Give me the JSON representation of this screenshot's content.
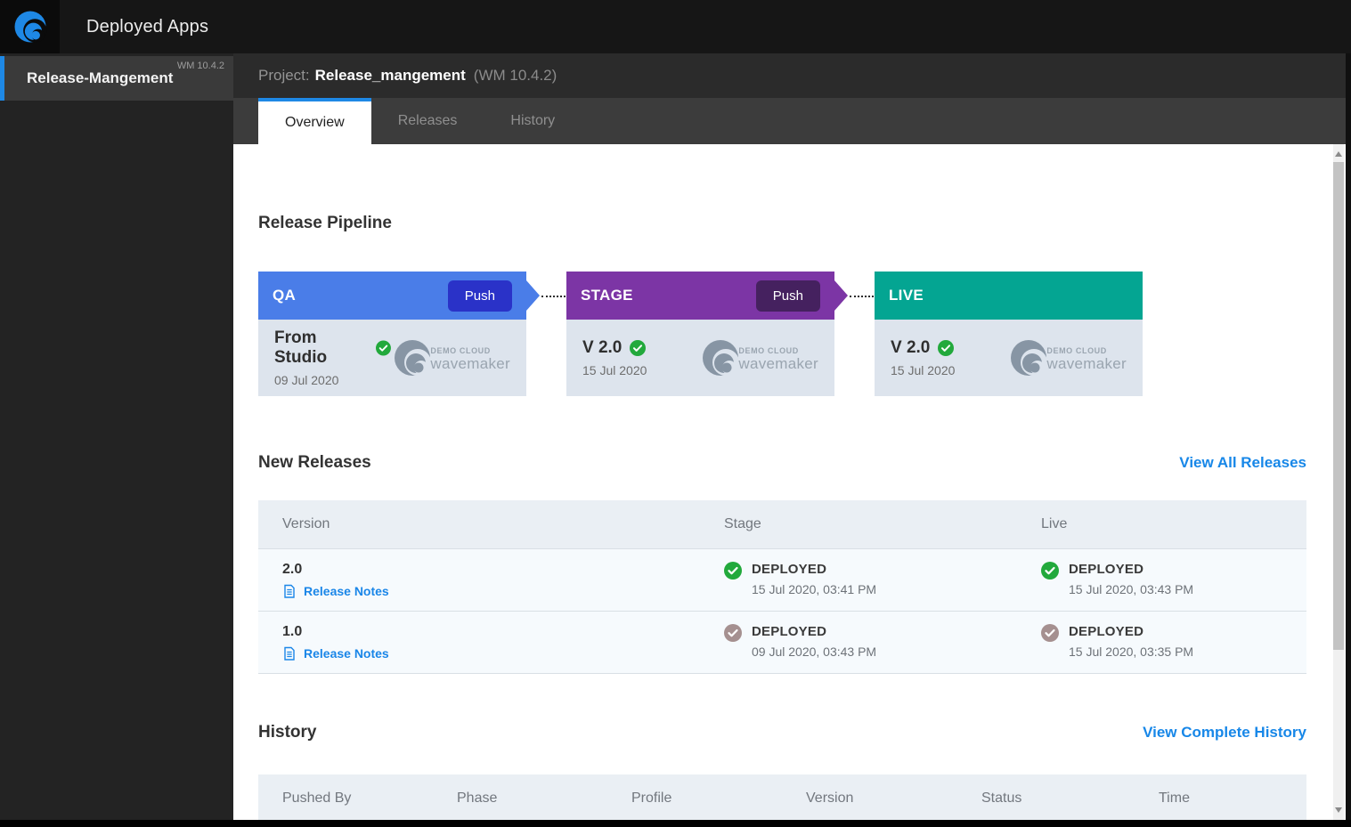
{
  "topbar": {
    "title": "Deployed Apps"
  },
  "sidebar": {
    "item": {
      "label": "Release-Mangement",
      "version": "WM 10.4.2"
    }
  },
  "project": {
    "prefix": "Project:",
    "name": "Release_mangement",
    "version": "(WM 10.4.2)"
  },
  "tabs": [
    {
      "label": "Overview",
      "active": true
    },
    {
      "label": "Releases",
      "active": false
    },
    {
      "label": "History",
      "active": false
    }
  ],
  "pipeline": {
    "title": "Release Pipeline",
    "stages": [
      {
        "name": "QA",
        "push_label": "Push",
        "version": "From Studio",
        "date": "09 Jul 2020",
        "status": "success",
        "cloud_line1": "DEMO CLOUD",
        "cloud_line2": "wavemaker",
        "header_color": "#4a7de8",
        "push_color": "#2a32c8"
      },
      {
        "name": "STAGE",
        "push_label": "Push",
        "version": "V 2.0",
        "date": "15 Jul 2020",
        "status": "success",
        "cloud_line1": "DEMO CLOUD",
        "cloud_line2": "wavemaker",
        "header_color": "#7c35a5",
        "push_color": "#45215f"
      },
      {
        "name": "LIVE",
        "version": "V 2.0",
        "date": "15 Jul 2020",
        "status": "success",
        "cloud_line1": "DEMO CLOUD",
        "cloud_line2": "wavemaker",
        "header_color": "#04a592"
      }
    ]
  },
  "new_releases": {
    "title": "New Releases",
    "view_link": "View All Releases",
    "columns": [
      "Version",
      "Stage",
      "Live"
    ],
    "rows": [
      {
        "version": "2.0",
        "release_notes_label": "Release Notes",
        "stage": {
          "status": "DEPLOYED",
          "time": "15 Jul 2020, 03:41 PM",
          "icon": "green-check"
        },
        "live": {
          "status": "DEPLOYED",
          "time": "15 Jul 2020, 03:43 PM",
          "icon": "green-check"
        }
      },
      {
        "version": "1.0",
        "release_notes_label": "Release Notes",
        "stage": {
          "status": "DEPLOYED",
          "time": "09 Jul 2020, 03:43 PM",
          "icon": "grey-check"
        },
        "live": {
          "status": "DEPLOYED",
          "time": "15 Jul 2020, 03:35 PM",
          "icon": "grey-check"
        }
      }
    ]
  },
  "history": {
    "title": "History",
    "view_link": "View Complete History",
    "columns": [
      "Pushed By",
      "Phase",
      "Profile",
      "Version",
      "Status",
      "Time"
    ]
  },
  "colors": {
    "accent_blue": "#1e88e5",
    "link_blue": "#1787e8",
    "qa_header": "#4a7de8",
    "qa_push": "#2a32c8",
    "stage_header": "#7c35a5",
    "stage_push": "#45215f",
    "live_header": "#04a592",
    "success_green": "#22a93c",
    "inactive_check": "#a59090"
  }
}
